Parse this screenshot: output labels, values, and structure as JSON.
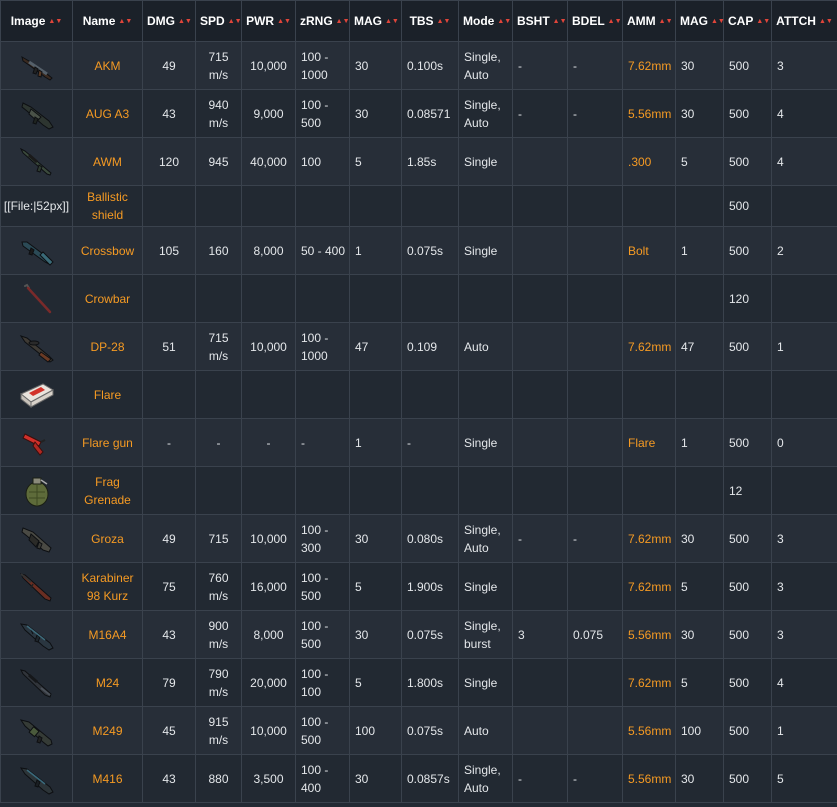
{
  "table": {
    "headers": [
      "Image",
      "Name",
      "DMG",
      "SPD",
      "PWR",
      "zRNG",
      "MAG",
      "TBS",
      "Mode",
      "BSHT",
      "BDEL",
      "AMM",
      "MAG",
      "CAP",
      "ATTCH"
    ],
    "sort_icon": "sort-arrows-icon",
    "accent_color": "#f59a23",
    "sort_color": "#e0453a",
    "rows": [
      {
        "image": "akm-rifle-icon",
        "name": "AKM",
        "dmg": "49",
        "spd": "715 m/s",
        "pwr": "10,000",
        "zrng": "100 - 1000",
        "mag": "30",
        "tbs": "0.100s",
        "mode": "Single, Auto",
        "bsht": "-",
        "bdel": "-",
        "amm": "7.62mm",
        "mag2": "30",
        "cap": "500",
        "attch": "3"
      },
      {
        "image": "aug-rifle-icon",
        "name": "AUG A3",
        "dmg": "43",
        "spd": "940 m/s",
        "pwr": "9,000",
        "zrng": "100 - 500",
        "mag": "30",
        "tbs": "0.08571",
        "mode": "Single, Auto",
        "bsht": "-",
        "bdel": "-",
        "amm": "5.56mm",
        "mag2": "30",
        "cap": "500",
        "attch": "4"
      },
      {
        "image": "awm-sniper-icon",
        "name": "AWM",
        "dmg": "120",
        "spd": "945",
        "pwr": "40,000",
        "zrng": "100",
        "mag": "5",
        "tbs": "1.85s",
        "mode": "Single",
        "bsht": "",
        "bdel": "",
        "amm": ".300",
        "mag2": "5",
        "cap": "500",
        "attch": "4"
      },
      {
        "image_text": "[[File:|52px]]",
        "name": "Ballistic shield",
        "dmg": "",
        "spd": "",
        "pwr": "",
        "zrng": "",
        "mag": "",
        "tbs": "",
        "mode": "",
        "bsht": "",
        "bdel": "",
        "amm": "",
        "mag2": "",
        "cap": "500",
        "attch": ""
      },
      {
        "image": "crossbow-icon",
        "name": "Crossbow",
        "dmg": "105",
        "spd": "160",
        "pwr": "8,000",
        "zrng": "50 - 400",
        "mag": "1",
        "tbs": "0.075s",
        "mode": "Single",
        "bsht": "",
        "bdel": "",
        "amm": "Bolt",
        "mag2": "1",
        "cap": "500",
        "attch": "2"
      },
      {
        "image": "crowbar-icon",
        "name": "Crowbar",
        "dmg": "",
        "spd": "",
        "pwr": "",
        "zrng": "",
        "mag": "",
        "tbs": "",
        "mode": "",
        "bsht": "",
        "bdel": "",
        "amm": "",
        "mag2": "",
        "cap": "120",
        "attch": ""
      },
      {
        "image": "dp28-lmg-icon",
        "name": "DP-28",
        "dmg": "51",
        "spd": "715 m/s",
        "pwr": "10,000",
        "zrng": "100 - 1000",
        "mag": "47",
        "tbs": "0.109",
        "mode": "Auto",
        "bsht": "",
        "bdel": "",
        "amm": "7.62mm",
        "mag2": "47",
        "cap": "500",
        "attch": "1"
      },
      {
        "image": "flare-box-icon",
        "name": "Flare",
        "dmg": "",
        "spd": "",
        "pwr": "",
        "zrng": "",
        "mag": "",
        "tbs": "",
        "mode": "",
        "bsht": "",
        "bdel": "",
        "amm": "",
        "mag2": "",
        "cap": "",
        "attch": ""
      },
      {
        "image": "flare-gun-icon",
        "name": "Flare gun",
        "dmg": "-",
        "spd": "-",
        "pwr": "-",
        "zrng": "-",
        "mag": "1",
        "tbs": "-",
        "mode": "Single",
        "bsht": "",
        "bdel": "",
        "amm": "Flare",
        "mag2": "1",
        "cap": "500",
        "attch": "0"
      },
      {
        "image": "frag-grenade-icon",
        "name": "Frag Grenade",
        "dmg": "",
        "spd": "",
        "pwr": "",
        "zrng": "",
        "mag": "",
        "tbs": "",
        "mode": "",
        "bsht": "",
        "bdel": "",
        "amm": "",
        "mag2": "",
        "cap": "12",
        "attch": ""
      },
      {
        "image": "groza-rifle-icon",
        "name": "Groza",
        "dmg": "49",
        "spd": "715",
        "pwr": "10,000",
        "zrng": "100 - 300",
        "mag": "30",
        "tbs": "0.080s",
        "mode": "Single, Auto",
        "bsht": "-",
        "bdel": "-",
        "amm": "7.62mm",
        "mag2": "30",
        "cap": "500",
        "attch": "3"
      },
      {
        "image": "kar98k-rifle-icon",
        "name": "Karabiner 98 Kurz",
        "dmg": "75",
        "spd": "760 m/s",
        "pwr": "16,000",
        "zrng": "100 - 500",
        "mag": "5",
        "tbs": "1.900s",
        "mode": "Single",
        "bsht": "",
        "bdel": "",
        "amm": "7.62mm",
        "mag2": "5",
        "cap": "500",
        "attch": "3"
      },
      {
        "image": "m16a4-rifle-icon",
        "name": "M16A4",
        "dmg": "43",
        "spd": "900 m/s",
        "pwr": "8,000",
        "zrng": "100 - 500",
        "mag": "30",
        "tbs": "0.075s",
        "mode": "Single, burst",
        "bsht": "3",
        "bdel": "0.075",
        "amm": "5.56mm",
        "mag2": "30",
        "cap": "500",
        "attch": "3"
      },
      {
        "image": "m24-sniper-icon",
        "name": "M24",
        "dmg": "79",
        "spd": "790 m/s",
        "pwr": "20,000",
        "zrng": "100 - 100",
        "mag": "5",
        "tbs": "1.800s",
        "mode": "Single",
        "bsht": "",
        "bdel": "",
        "amm": "7.62mm",
        "mag2": "5",
        "cap": "500",
        "attch": "4"
      },
      {
        "image": "m249-lmg-icon",
        "name": "M249",
        "dmg": "45",
        "spd": "915 m/s",
        "pwr": "10,000",
        "zrng": "100 - 500",
        "mag": "100",
        "tbs": "0.075s",
        "mode": "Auto",
        "bsht": "",
        "bdel": "",
        "amm": "5.56mm",
        "mag2": "100",
        "cap": "500",
        "attch": "1"
      },
      {
        "image": "m416-rifle-icon",
        "name": "M416",
        "dmg": "43",
        "spd": "880",
        "pwr": "3,500",
        "zrng": "100 - 400",
        "mag": "30",
        "tbs": "0.0857s",
        "mode": "Single, Auto",
        "bsht": "-",
        "bdel": "-",
        "amm": "5.56mm",
        "mag2": "30",
        "cap": "500",
        "attch": "5"
      }
    ]
  }
}
